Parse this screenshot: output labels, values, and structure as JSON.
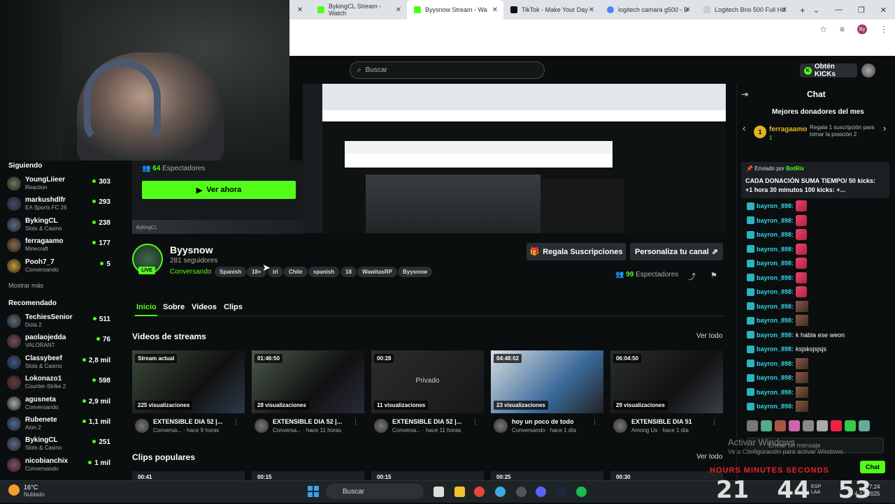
{
  "browser": {
    "tabs": [
      {
        "label": "BykingCL Stream - Watch",
        "color": "#53fc18"
      },
      {
        "label": "Byysnow Stream - Wa",
        "color": "#53fc18",
        "active": true
      },
      {
        "label": "TikTok - Make Your Day",
        "color": "#111111"
      },
      {
        "label": "logitech camara g500 - B",
        "color": "#4285f4"
      },
      {
        "label": "Logitech Brio 500 Full Hd",
        "color": "#e8e8e8"
      }
    ],
    "new_tab": "+",
    "profile_initials": "By"
  },
  "topnav": {
    "search_placeholder": "Buscar",
    "kicks_label": "Obtén KICKs"
  },
  "sidebar": {
    "following_title": "Siguiendo",
    "following": [
      {
        "name": "YoungLiieer",
        "category": "Reaction",
        "viewers": "303"
      },
      {
        "name": "markushdlfr",
        "category": "EA Sports FC 26",
        "viewers": "293"
      },
      {
        "name": "BykingCL",
        "category": "Slots & Casino",
        "viewers": "238"
      },
      {
        "name": "ferragaamo",
        "category": "Minecraft",
        "viewers": "177"
      },
      {
        "name": "Pooh7_7",
        "category": "Conversando",
        "viewers": "5"
      }
    ],
    "show_more": "Mostrar más",
    "recommended_title": "Recomendado",
    "recommended": [
      {
        "name": "TechiesSenior",
        "category": "Dota 2",
        "viewers": "511"
      },
      {
        "name": "paolaojedda",
        "category": "VALORANT",
        "viewers": "76"
      },
      {
        "name": "Classybeef",
        "category": "Slots & Casino",
        "viewers": "2,8 mil"
      },
      {
        "name": "Lokonazo1",
        "category": "Counter-Strike 2",
        "viewers": "598"
      },
      {
        "name": "agusneta",
        "category": "Conversando",
        "viewers": "2,9 mil"
      },
      {
        "name": "Rubenete",
        "category": "Aion 2",
        "viewers": "1,1 mil"
      },
      {
        "name": "BykingCL",
        "category": "Slots & Casino",
        "viewers": "251"
      },
      {
        "name": "nicobianchix",
        "category": "Conversando",
        "viewers": "1 mil"
      }
    ]
  },
  "preview": {
    "viewers_count": "64",
    "viewers_label": "Espectadores",
    "watch_now": "Ver ahora",
    "thumb_caption": "BykingCL"
  },
  "channel": {
    "name": "Byysnow",
    "followers": "281 seguidores",
    "status": "Conversando",
    "live": "LIVE",
    "tags": [
      "Spanish",
      "18+",
      "irl",
      "Chile",
      "spanish",
      "18",
      "WawitasRP",
      "Byysnow"
    ],
    "gift_label": "Regala Suscripciones",
    "customize_label": "Personaliza tu canal",
    "viewers_count": "99",
    "viewers_label": "Espectadores"
  },
  "page_tabs": [
    "Inicio",
    "Sobre",
    "Videos",
    "Clips"
  ],
  "videos": {
    "title": "Videos de streams",
    "see_all": "Ver todo",
    "items": [
      {
        "duration": "Stream actual",
        "views": "225 visualizaciones",
        "title": "EXTENSIBLE DIA 52 |...",
        "meta": "Conversa... · hace 9 horas"
      },
      {
        "duration": "01:46:50",
        "views": "28 visualizaciones",
        "title": "EXTENSIBLE DIA 52 |...",
        "meta": "Conversa... · hace 11 horas"
      },
      {
        "duration": "00:28",
        "views": "11 visualizaciones",
        "title": "EXTENSIBLE DIA 52 |...",
        "meta": "Conversa... · hace 11 horas",
        "private": "Privado"
      },
      {
        "duration": "04:48:02",
        "views": "23 visualizaciones",
        "title": "hoy un poco de todo",
        "meta": "Conversando · hace 1 día"
      },
      {
        "duration": "06:04:50",
        "views": "29 visualizaciones",
        "title": "EXTENSIBLE DIA 51",
        "meta": "Among Us · hace 1 día"
      }
    ]
  },
  "clips": {
    "title": "Clips populares",
    "see_all": "Ver todo",
    "durations": [
      "00:41",
      "00:15",
      "00:15",
      "00:25",
      "00:30"
    ]
  },
  "chat": {
    "title": "Chat",
    "donors_title": "Mejores donadores del mes",
    "donor_rank": "1",
    "donor_name": "ferragaamo",
    "donor_amount": "1",
    "donor_prompt": "Regala 1 suscripción para tomar la posición 2",
    "pinned_by_label": "Enviado por",
    "pinned_by": "BotRix",
    "pinned_message": "CADA DONACIÓN SUMA TIEMPO/ 50 kicks: +1 hora 30 minutos 100 kicks: +...",
    "messages": [
      {
        "user": "bayron_898:",
        "text": "",
        "emote": "em"
      },
      {
        "user": "bayron_898:",
        "text": "",
        "emote": "em"
      },
      {
        "user": "bayron_898:",
        "text": "",
        "emote": "em"
      },
      {
        "user": "bayron_898:",
        "text": "",
        "emote": "em"
      },
      {
        "user": "bayron_898:",
        "text": "",
        "emote": "em"
      },
      {
        "user": "bayron_898:",
        "text": "",
        "emote": "em"
      },
      {
        "user": "bayron_898:",
        "text": "",
        "emote": "em"
      },
      {
        "user": "bayron_898:",
        "text": "",
        "emote": "em2"
      },
      {
        "user": "bayron_898:",
        "text": "",
        "emote": "em2"
      },
      {
        "user": "bayron_898:",
        "text": "k habla ese weon",
        "emote": ""
      },
      {
        "user": "bayron_898:",
        "text": "ksjsksjsjsjs",
        "emote": ""
      },
      {
        "user": "bayron_898:",
        "text": "",
        "emote": "em2"
      },
      {
        "user": "bayron_898:",
        "text": "",
        "emote": "em2"
      },
      {
        "user": "bayron_898:",
        "text": "",
        "emote": "em2"
      },
      {
        "user": "bayron_898:",
        "text": "",
        "emote": "em2"
      }
    ],
    "input_placeholder": "Enviar un mensaje",
    "send_label": "Chat",
    "activate_title": "Activar Windows",
    "activate_sub": "Ve a Configuración para activar Windows."
  },
  "timer": {
    "labels": "HOURS   MINUTES   SECONDS",
    "hours": "21",
    "minutes": "44",
    "seconds": "53"
  },
  "taskbar": {
    "temperature": "16°C",
    "weather": "Nublado",
    "search": "Buscar",
    "lang1": "ESP",
    "lang2": "LAA",
    "time": "7:24",
    "date": "4-12-2025"
  }
}
